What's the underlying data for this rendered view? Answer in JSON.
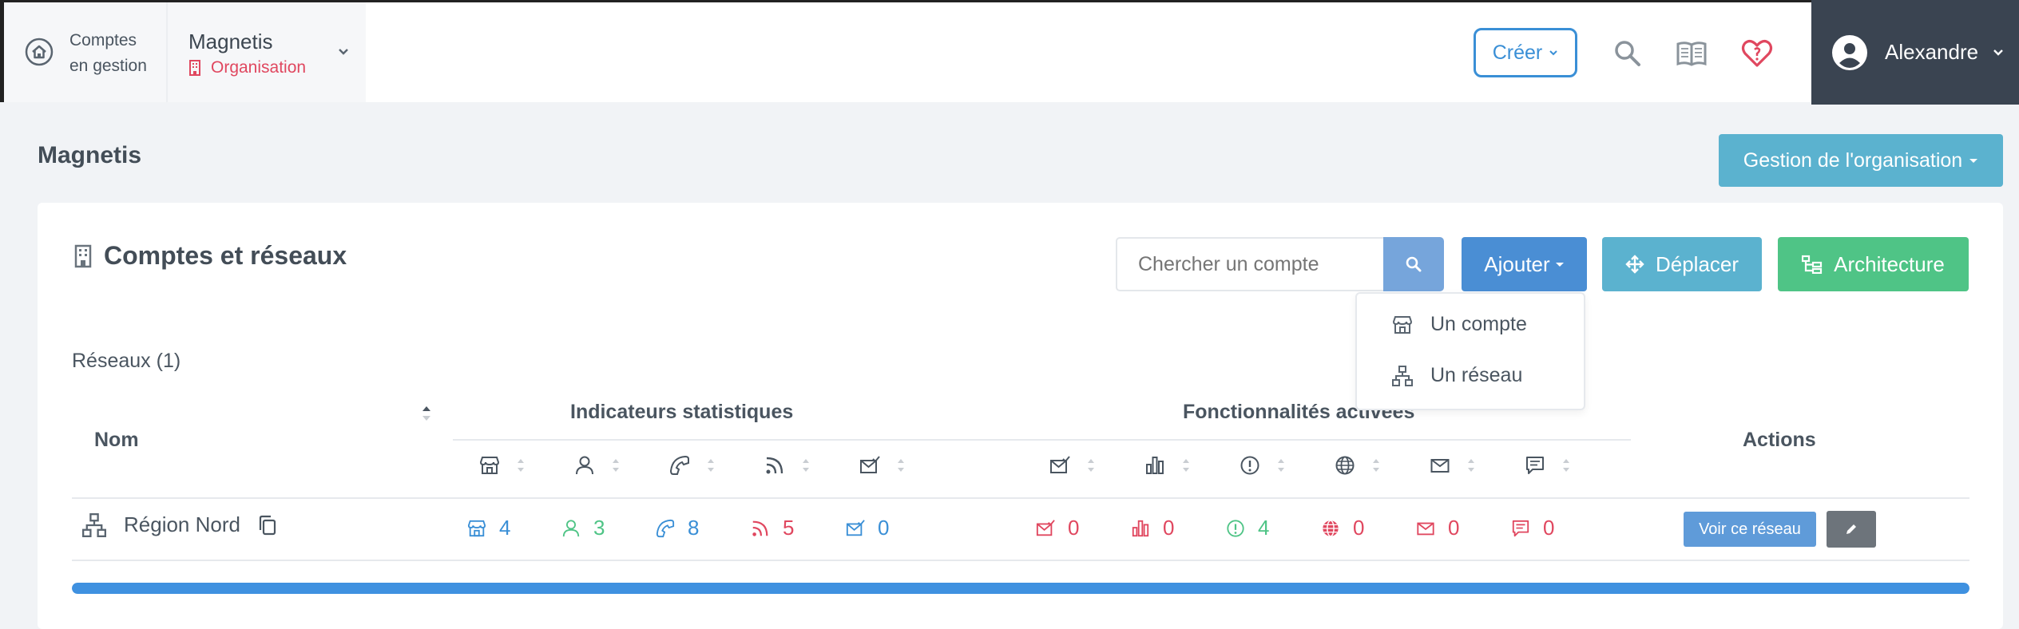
{
  "header": {
    "home_line1": "Comptes",
    "home_line2": "en gestion",
    "org_name": "Magnetis",
    "org_type": "Organisation",
    "create_label": "Créer",
    "user_name": "Alexandre"
  },
  "page": {
    "title": "Magnetis",
    "manage_label": "Gestion de l'organisation"
  },
  "card": {
    "title": "Comptes et réseaux",
    "search_placeholder": "Chercher un compte",
    "add_label": "Ajouter",
    "move_label": "Déplacer",
    "architecture_label": "Architecture",
    "dropdown": [
      "Un compte",
      "Un réseau"
    ],
    "networks_label": "Réseaux (1)"
  },
  "table": {
    "col_name": "Nom",
    "group_stats": "Indicateurs statistiques",
    "group_features": "Fonctionnalités activées",
    "col_actions": "Actions",
    "stat_icons": [
      "store-icon",
      "user-icon",
      "phone-icon",
      "rss-icon",
      "mail-check-icon"
    ],
    "feature_icons": [
      "mail-check-icon",
      "bar-chart-icon",
      "alert-circle-icon",
      "globe-icon",
      "mail-icon",
      "message-icon"
    ],
    "row": {
      "name": "Région Nord",
      "stats": [
        "4",
        "3",
        "8",
        "5",
        "0"
      ],
      "features": [
        "0",
        "0",
        "4",
        "0",
        "0",
        "0"
      ],
      "view_label": "Voir ce réseau"
    }
  },
  "colors": {
    "blue": "#3a8fd6",
    "green": "#4fc486",
    "red": "#e0475f",
    "teal": "#5bb2cf"
  },
  "progress": 1.0
}
